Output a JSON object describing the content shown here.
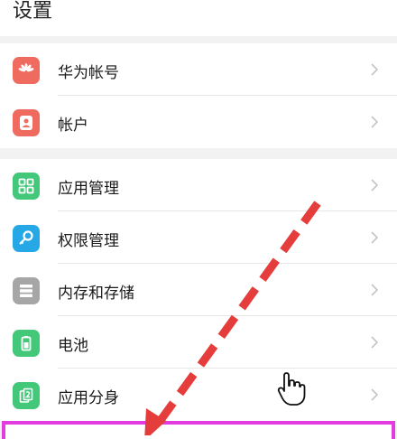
{
  "header": {
    "title": "设置"
  },
  "colors": {
    "huawei_icon": "#ef6a5f",
    "account_icon": "#ef6a5f",
    "apps_icon": "#43c87a",
    "permission_icon": "#27a8e6",
    "storage_icon": "#a6a6a6",
    "battery_icon": "#43c87a",
    "clone_icon": "#43c87a",
    "highlight": "#e23ce0",
    "arrow": "#e43d3b"
  },
  "group1": {
    "items": [
      {
        "label": "华为帐号",
        "icon": "huawei-logo-icon"
      },
      {
        "label": "帐户",
        "icon": "user-account-icon"
      }
    ]
  },
  "group2": {
    "items": [
      {
        "label": "应用管理",
        "icon": "app-grid-icon"
      },
      {
        "label": "权限管理",
        "icon": "key-icon"
      },
      {
        "label": "内存和存储",
        "icon": "storage-icon"
      },
      {
        "label": "电池",
        "icon": "battery-icon"
      },
      {
        "label": "应用分身",
        "icon": "app-clone-icon"
      }
    ]
  }
}
